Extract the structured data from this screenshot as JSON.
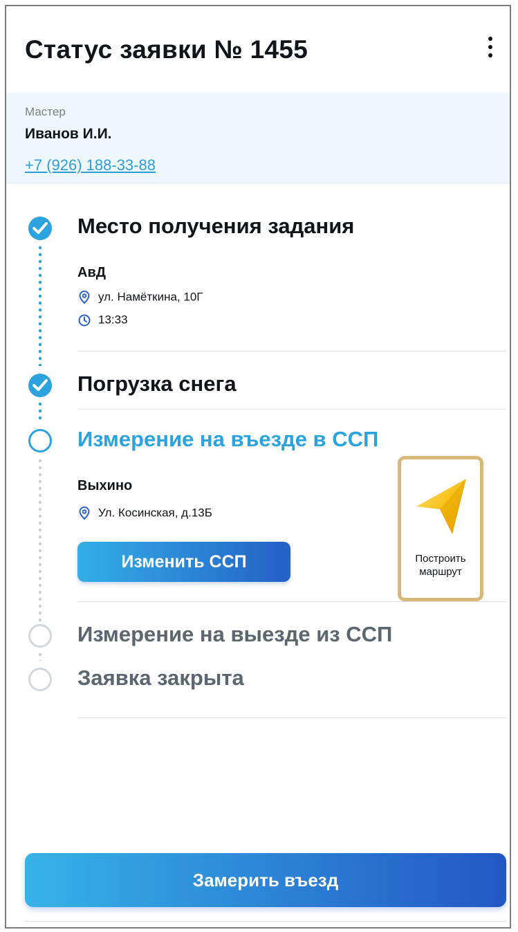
{
  "header": {
    "title": "Статус заявки № 1455",
    "menu_icon": "kebab-menu-icon"
  },
  "master": {
    "label": "Мастер",
    "name": "Иванов И.И.",
    "phone": "+7 (926) 188-33-88"
  },
  "steps": [
    {
      "title": "Место получения задания",
      "status": "done",
      "place": "АвД",
      "address": "ул. Намёткина, 10Г",
      "time": "13:33"
    },
    {
      "title": "Погрузка снега",
      "status": "done"
    },
    {
      "title": "Измерение на въезде в ССП",
      "status": "active",
      "place": "Выхино",
      "address": "Ул. Косинская, д.13Б",
      "change_button": "Изменить ССП"
    },
    {
      "title": "Измерение на выезде из ССП",
      "status": "pending"
    },
    {
      "title": "Заявка закрыта",
      "status": "pending"
    }
  ],
  "route": {
    "line1": "Построить",
    "line2": "маршрут",
    "icon": "navigation-arrow-icon"
  },
  "footer": {
    "primary_button": "Замерить въезд"
  },
  "colors": {
    "accent": "#2aa3df",
    "button_gradient_start": "#33aee6",
    "button_gradient_end": "#2361c6",
    "master_bg": "#eef7fc",
    "route_border": "#d8b97a",
    "route_arrow": "#f7c21a"
  }
}
